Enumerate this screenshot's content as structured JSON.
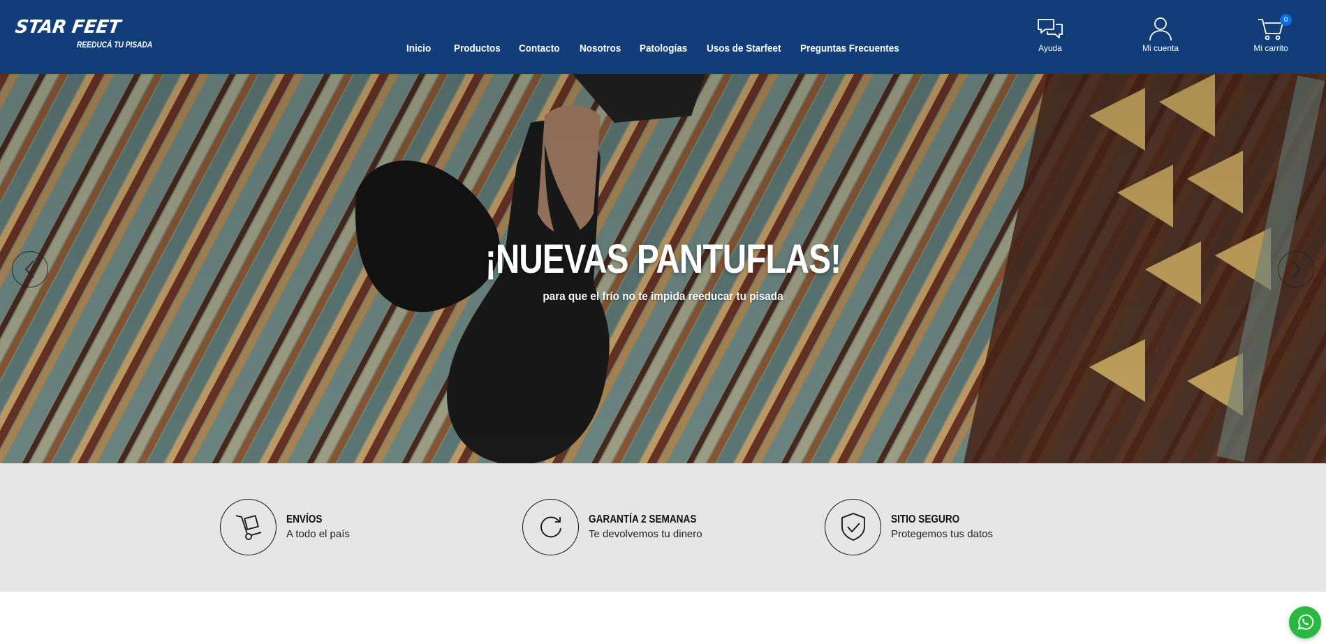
{
  "header": {
    "logo": {
      "name": "STAR FEET",
      "tagline": "REEDUCÁ TU PISADA"
    },
    "nav": [
      "Inicio",
      "Productos",
      "Contacto",
      "Nosotros",
      "Patologías",
      "Usos de Starfeet",
      "Preguntas Frecuentes"
    ],
    "actions": {
      "help": "Ayuda",
      "account": "Mi cuenta",
      "cart": "Mi carrito",
      "cart_count": "0"
    }
  },
  "hero": {
    "title": "¡NUEVAS PANTUFLAS!",
    "subtitle": "para que el frío no te impida reeducar tu pisada"
  },
  "features": [
    {
      "icon": "hand-truck-icon",
      "title": "ENVÍOS",
      "desc": "A todo el país"
    },
    {
      "icon": "refresh-icon",
      "title": "GARANTÍA 2 SEMANAS",
      "desc": "Te devolvemos tu dinero"
    },
    {
      "icon": "shield-check-icon",
      "title": "SITIO SEGURO",
      "desc": "Protegemos tus datos"
    }
  ],
  "colors": {
    "header_bg": "#113d78",
    "features_bg": "#e5e5e5",
    "whatsapp": "#2ab940",
    "cart_badge": "#0b6fe0"
  }
}
